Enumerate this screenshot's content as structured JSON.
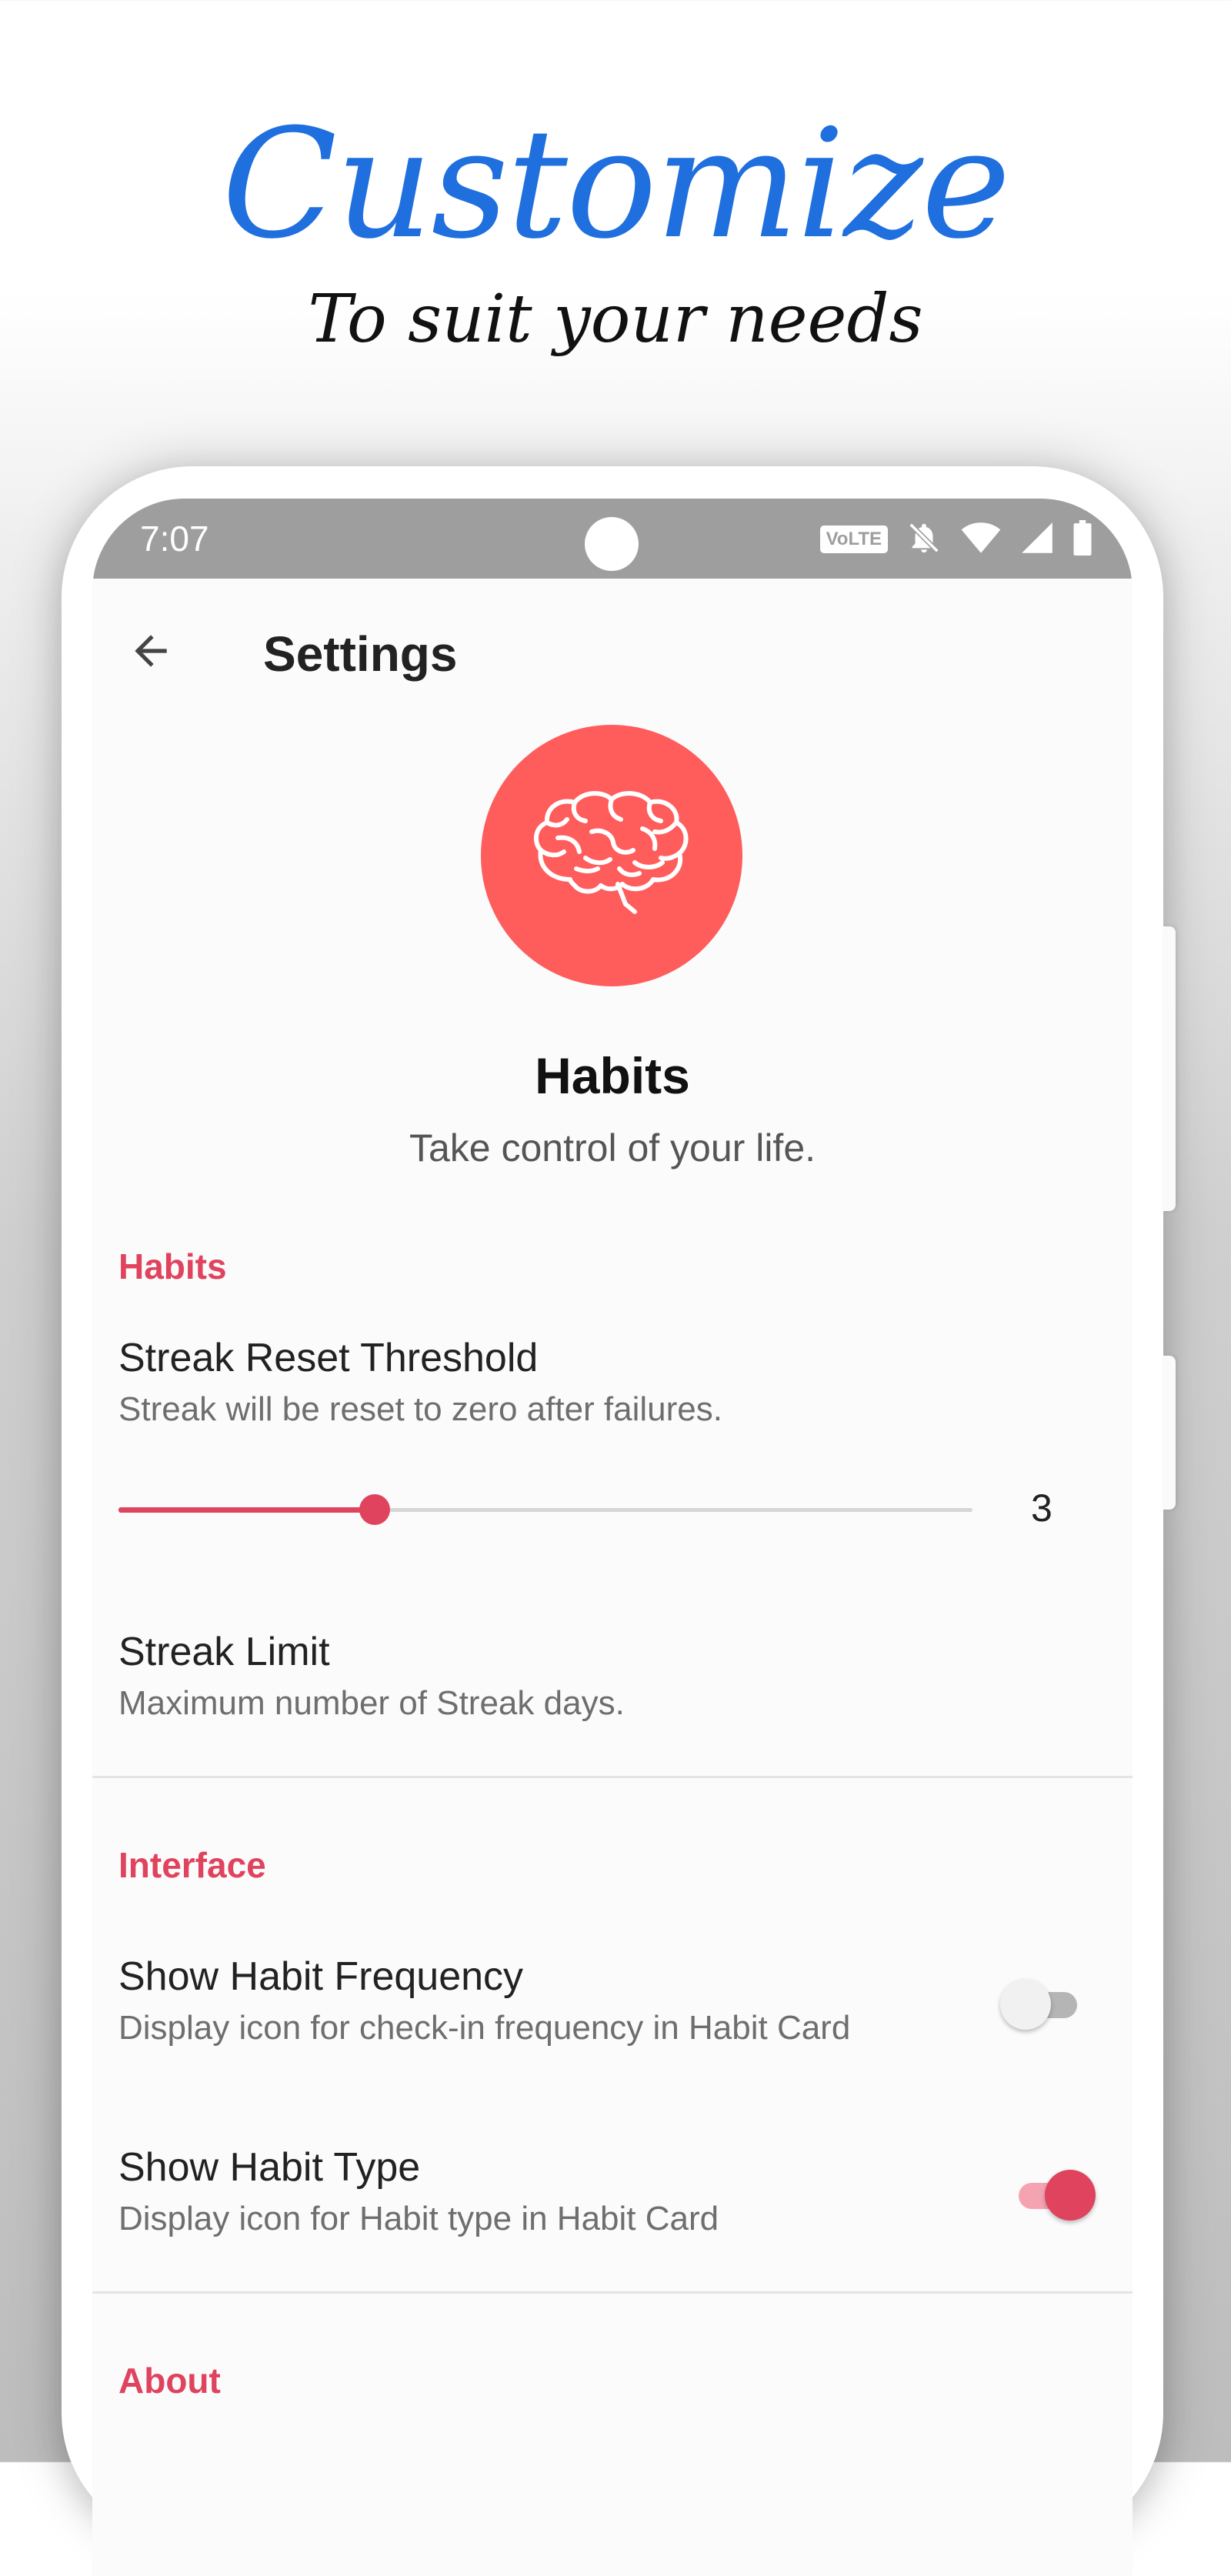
{
  "promo": {
    "title": "Customize",
    "subtitle": "To suit your needs"
  },
  "status_bar": {
    "time": "7:07",
    "volte": "VoLTE",
    "icons": [
      "volte-icon",
      "bell-off-icon",
      "wifi-icon",
      "signal-icon",
      "battery-icon"
    ]
  },
  "app_bar": {
    "title": "Settings",
    "back_icon": "arrow-back-icon"
  },
  "header": {
    "logo_icon": "brain-icon",
    "logo_color": "#ff5c5c",
    "app_name": "Habits",
    "tagline": "Take control of your life."
  },
  "accent_color": "#e0435e",
  "sections": {
    "habits": {
      "header": "Habits",
      "streak_reset": {
        "title": "Streak Reset Threshold",
        "summary": "Streak will be reset to zero after failures.",
        "value": "3",
        "slider_fraction": 0.3
      },
      "streak_limit": {
        "title": "Streak Limit",
        "summary": "Maximum number of Streak days."
      }
    },
    "interface": {
      "header": "Interface",
      "show_frequency": {
        "title": "Show Habit Frequency",
        "summary": "Display icon for check-in frequency in Habit Card",
        "enabled": false
      },
      "show_type": {
        "title": "Show Habit Type",
        "summary": "Display icon for Habit type in Habit Card",
        "enabled": true
      }
    },
    "about": {
      "header": "About"
    }
  }
}
